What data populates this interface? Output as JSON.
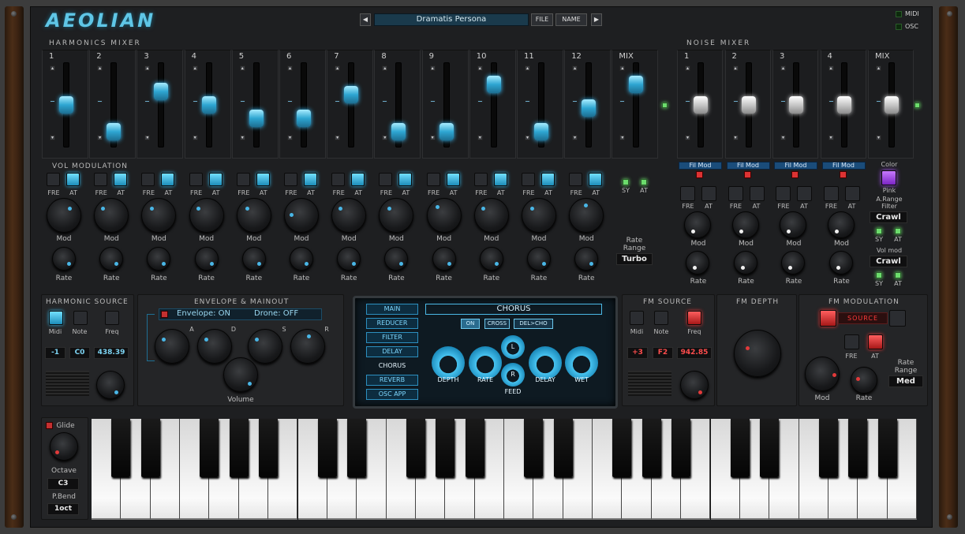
{
  "app": {
    "logo": "AEOLIAN"
  },
  "preset": {
    "prev": "◀",
    "name": "Dramatis Persona",
    "file": "FILE",
    "name_btn": "NAME",
    "next": "▶"
  },
  "io": {
    "midi": "MIDI",
    "osc": "OSC"
  },
  "harmonics": {
    "title": "HARMONICS MIXER",
    "labels": [
      "1",
      "2",
      "3",
      "4",
      "5",
      "6",
      "7",
      "8",
      "9",
      "10",
      "11",
      "12",
      "MIX"
    ],
    "levels": [
      0.5,
      0.1,
      0.7,
      0.5,
      0.3,
      0.3,
      0.65,
      0.1,
      0.1,
      0.8,
      0.1,
      0.45,
      0.8
    ]
  },
  "noise": {
    "title": "NOISE MIXER",
    "labels": [
      "1",
      "2",
      "3",
      "4",
      "MIX"
    ],
    "levels": [
      0.5,
      0.5,
      0.5,
      0.5,
      0.5
    ]
  },
  "volmod": {
    "title": "VOL MODULATION",
    "fre": "FRE",
    "at": "AT",
    "mod": "Mod",
    "rate": "Rate",
    "sy": "SY",
    "rate_range_label": "Rate Range",
    "rate_range": "Turbo"
  },
  "noisemod": {
    "filmod": "Fil Mod",
    "color_label": "Color",
    "color_value": "Pink",
    "range_filter_label": "A.Range Filter",
    "range_filter": "Crawl",
    "volmod_label": "Vol mod",
    "volmod": "Crawl"
  },
  "harm_source": {
    "title": "HARMONIC SOURCE",
    "midi": "Midi",
    "note": "Note",
    "freq": "Freq",
    "midi_val": "-1",
    "note_val": "C0",
    "freq_val": "438.39"
  },
  "envelope": {
    "title": "ENVELOPE & MAINOUT",
    "envelope": "Envelope: ON",
    "drone": "Drone: OFF",
    "a": "A",
    "d": "D",
    "s": "S",
    "r": "R",
    "volume": "Volume"
  },
  "screen": {
    "menu": [
      "MAIN",
      "REDUCER",
      "FILTER",
      "DELAY",
      "CHORUS",
      "REVERB",
      "OSC APP"
    ],
    "header": "CHORUS",
    "on": "ON",
    "cross": "CROSS",
    "delcho": "DEL>CHO",
    "l": "L",
    "r": "R",
    "knobs": [
      "DEPTH",
      "RATE",
      "DELAY",
      "WET"
    ],
    "feed": "FEED"
  },
  "fm_source": {
    "title": "FM SOURCE",
    "midi": "Midi",
    "note": "Note",
    "freq": "Freq",
    "midi_val": "+3",
    "note_val": "F2",
    "freq_val": "942.85"
  },
  "fm_depth": {
    "title": "FM DEPTH"
  },
  "fm_mod": {
    "title": "FM MODULATION",
    "source": "SOURCE",
    "fre": "FRE",
    "at": "AT",
    "mod": "Mod",
    "rate": "Rate",
    "rate_range_label": "Rate Range",
    "rate_range": "Med"
  },
  "keyboard": {
    "glide": "Glide",
    "octave_label": "Octave",
    "octave": "C3",
    "pbend_label": "P.Bend",
    "pbend": "1oct"
  },
  "colors": {
    "accent": "#4ec3ef",
    "red": "#e33a3a",
    "green": "#6cdc6c"
  }
}
